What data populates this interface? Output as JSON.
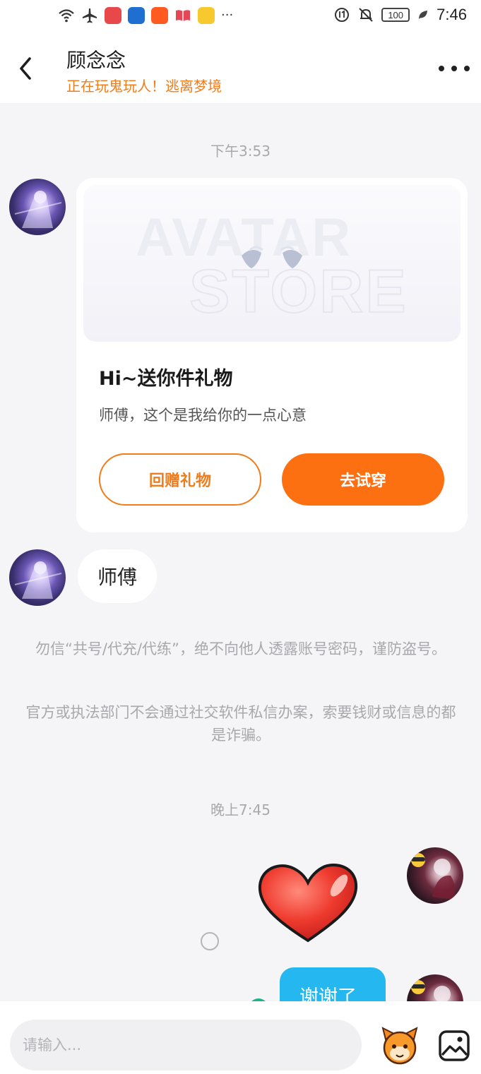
{
  "status_bar": {
    "battery": "100",
    "time": "7:46",
    "more": "···"
  },
  "header": {
    "contact_name": "顾念念",
    "contact_status": "正在玩鬼玩人！逃离梦境"
  },
  "timestamps": {
    "first": "下午3:53",
    "second": "晚上7:45"
  },
  "gift_card": {
    "banner_text_top": "AVATAR",
    "banner_text_bottom": "STORE",
    "title": "Hi~送你件礼物",
    "description": "师傅，这个是我给你的一点心意",
    "return_gift_label": "回赠礼物",
    "try_on_label": "去试穿"
  },
  "messages": {
    "incoming_text": "师傅",
    "outgoing_text": "谢谢了"
  },
  "notices": {
    "line1": "勿信“共号/代充/代练”，绝不向他人透露账号密码，谨防盗号。",
    "line2": "官方或执法部门不会通过社交软件私信办案，索要钱财或信息的都是诈骗。"
  },
  "input": {
    "placeholder": "请输入..."
  },
  "colors": {
    "accent": "#fd7012",
    "status_orange": "#f07c1c",
    "outgoing_bubble": "#25b8f0",
    "background": "#f5f5f8"
  },
  "icons": {
    "status_left": [
      "wifi-icon",
      "airplane-icon",
      "huawei-app-icon",
      "security-app-icon",
      "kuaishou-app-icon",
      "book-app-icon",
      "notes-app-icon"
    ],
    "status_right": [
      "data-saver-icon",
      "mute-bell-icon",
      "battery-icon",
      "leaf-icon"
    ],
    "header": [
      "back-arrow-icon",
      "more-icon"
    ],
    "bottom": [
      "sticker-icon",
      "image-icon"
    ]
  }
}
